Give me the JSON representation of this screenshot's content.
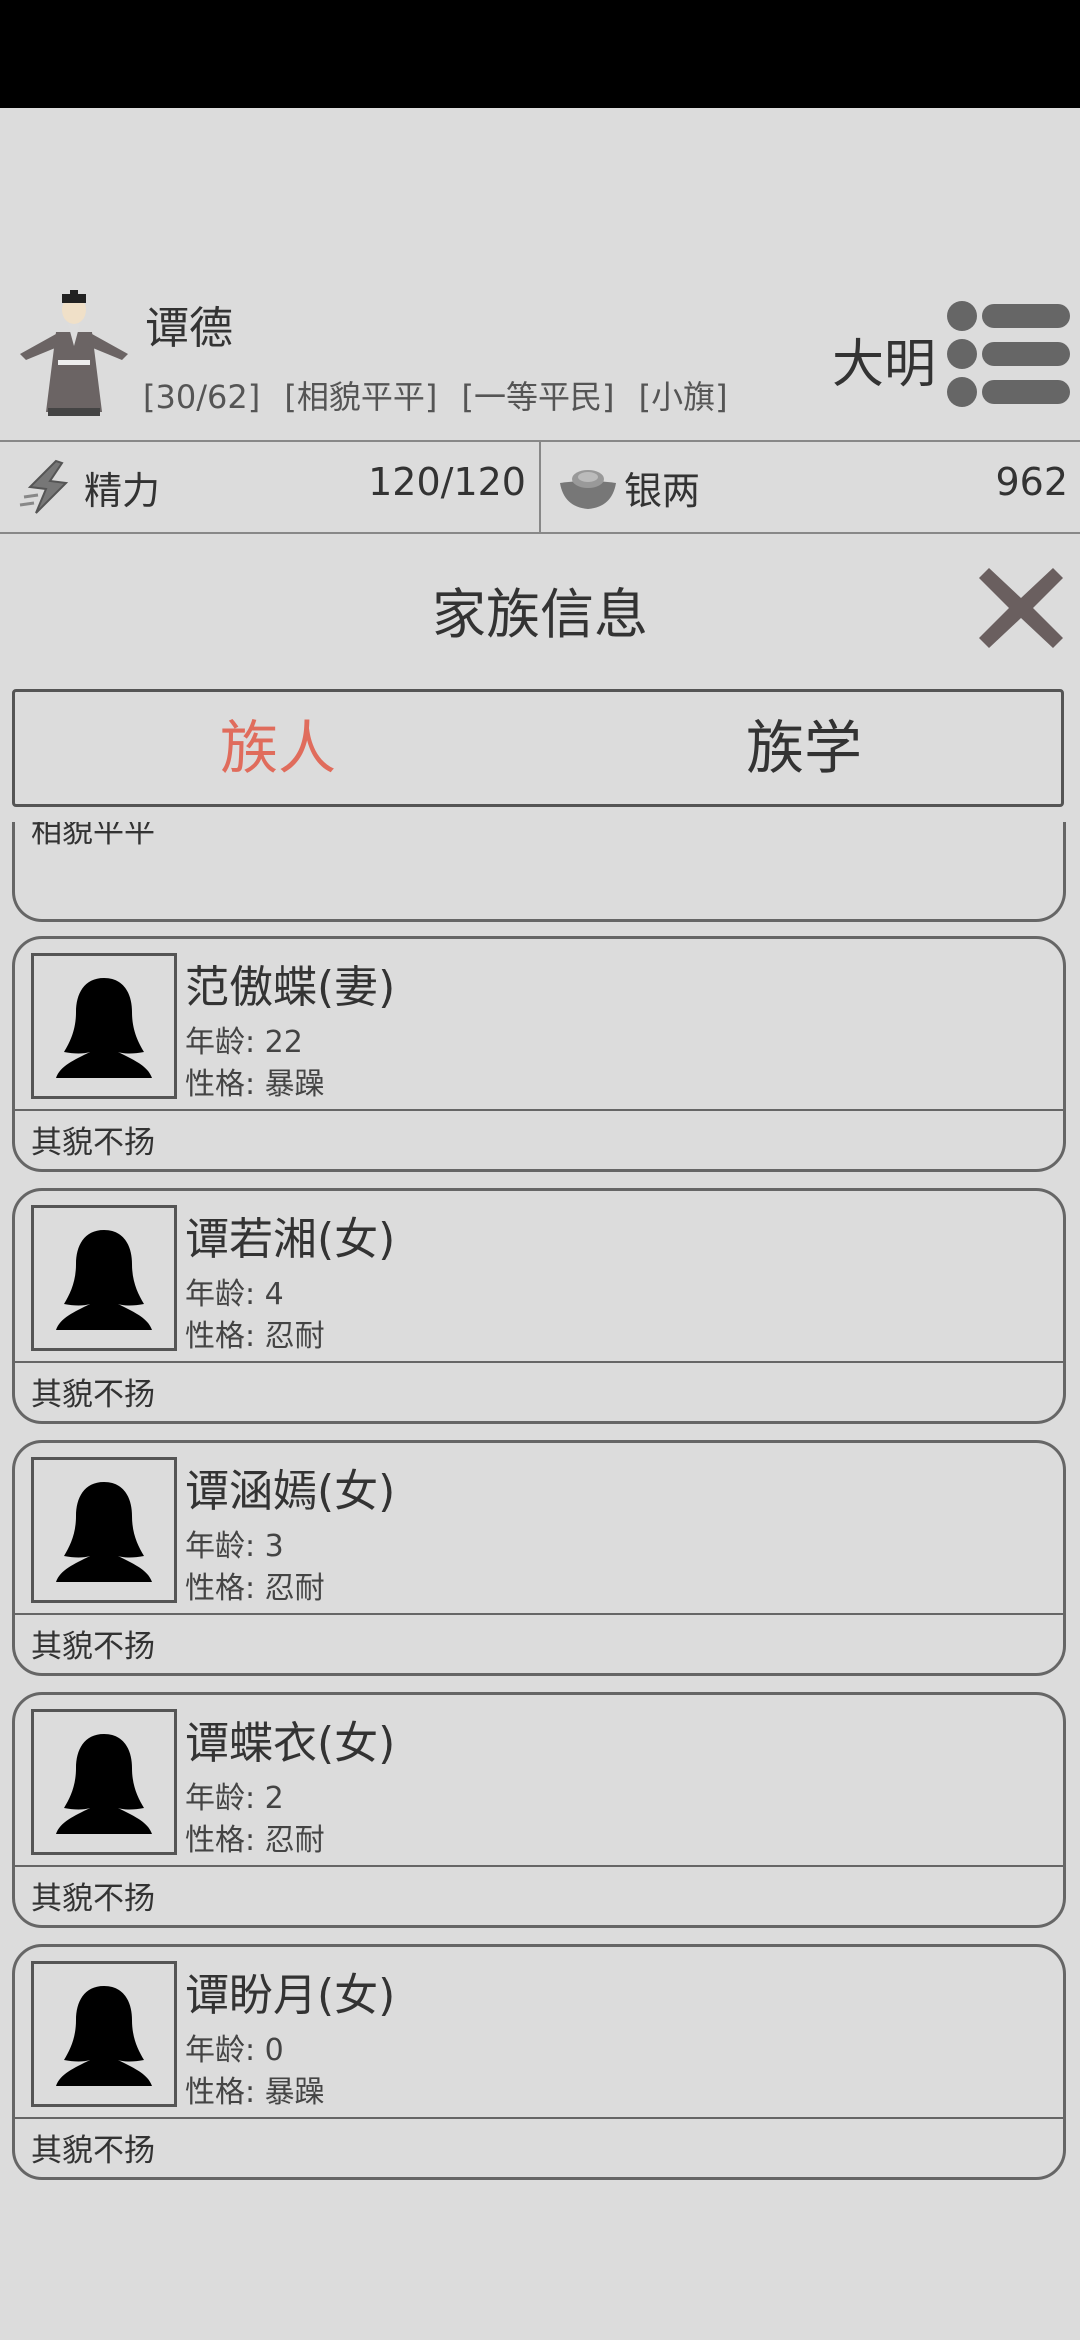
{
  "player": {
    "name": "谭德",
    "tags": [
      "[30/62]",
      "[相貌平平]",
      "[一等平民]",
      "[小旗]"
    ],
    "dynasty": "大明"
  },
  "resources": [
    {
      "label": "精力",
      "value": "120/120",
      "icon": "energy-bolt-icon"
    },
    {
      "label": "银两",
      "value": "962",
      "icon": "silver-ingot-icon"
    }
  ],
  "panel": {
    "title": "家族信息"
  },
  "tabs": [
    {
      "label": "族人",
      "active": true
    },
    {
      "label": "族学",
      "active": false
    }
  ],
  "partial_card": {
    "looks": "相貌平平"
  },
  "members": [
    {
      "name": "范傲蝶(妻)",
      "age": "年龄: 22",
      "personality": "性格: 暴躁",
      "looks": "其貌不扬"
    },
    {
      "name": "谭若湘(女)",
      "age": "年龄: 4",
      "personality": "性格: 忍耐",
      "looks": "其貌不扬"
    },
    {
      "name": "谭涵嫣(女)",
      "age": "年龄: 3",
      "personality": "性格: 忍耐",
      "looks": "其貌不扬"
    },
    {
      "name": "谭蝶衣(女)",
      "age": "年龄: 2",
      "personality": "性格: 忍耐",
      "looks": "其貌不扬"
    },
    {
      "name": "谭盼月(女)",
      "age": "年龄: 0",
      "personality": "性格: 暴躁",
      "looks": "其貌不扬"
    }
  ],
  "colors": {
    "active_tab": "#e06c5c",
    "background": "#dcdcdc",
    "border": "#666666"
  }
}
